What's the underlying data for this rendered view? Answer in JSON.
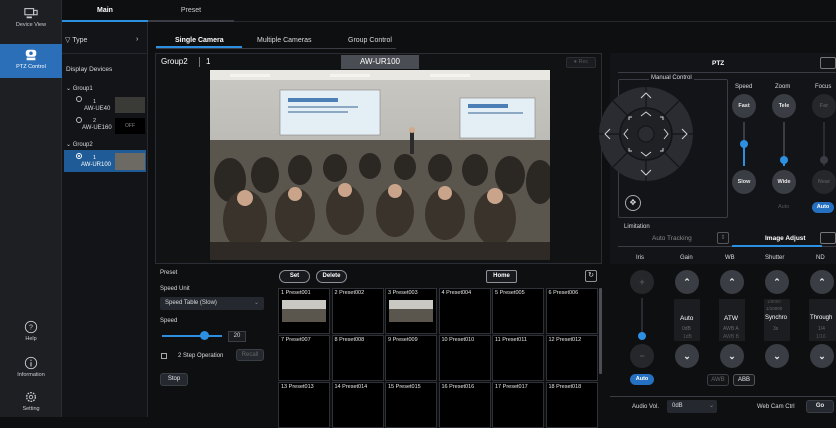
{
  "rail": {
    "device_view": "Device View",
    "ptz_control": "PTZ Control",
    "help": "Help",
    "information": "Information",
    "setting": "Setting"
  },
  "tabs": {
    "main": "Main",
    "preset": "Preset",
    "single_camera": "Single Camera",
    "multiple_cameras": "Multiple Cameras",
    "group_control": "Group Control"
  },
  "devices": {
    "type_label": "Type",
    "display_devices": "Display Devices",
    "group1": "Group1",
    "group2": "Group2",
    "dev1_num": "1",
    "dev1_name": "AW-UE40",
    "dev2_num": "2",
    "dev2_name": "AW-UE160",
    "dev2_status": "OFF",
    "dev3_num": "1",
    "dev3_name": "AW-UR100"
  },
  "viewer": {
    "group": "Group2",
    "num": "1",
    "camera_name": "AW-UR100",
    "rec": "Rec"
  },
  "preset_panel": {
    "title": "Preset",
    "speed_unit": "Speed Unit",
    "speed_table": "Speed Table (Slow)",
    "speed": "Speed",
    "speed_value": "20",
    "two_step": "2 Step Operation",
    "recall": "Recall",
    "stop": "Stop",
    "set": "Set",
    "delete": "Delete",
    "home": "Home"
  },
  "presets": [
    {
      "num": "1",
      "name": "Preset001",
      "thumb": true
    },
    {
      "num": "2",
      "name": "Preset002",
      "thumb": false
    },
    {
      "num": "3",
      "name": "Preset003",
      "thumb": true
    },
    {
      "num": "4",
      "name": "Preset004",
      "thumb": false
    },
    {
      "num": "5",
      "name": "Preset005",
      "thumb": false
    },
    {
      "num": "6",
      "name": "Preset006",
      "thumb": false
    },
    {
      "num": "7",
      "name": "Preset007",
      "thumb": false
    },
    {
      "num": "8",
      "name": "Preset008",
      "thumb": false
    },
    {
      "num": "9",
      "name": "Preset009",
      "thumb": false
    },
    {
      "num": "10",
      "name": "Preset010",
      "thumb": false
    },
    {
      "num": "11",
      "name": "Preset011",
      "thumb": false
    },
    {
      "num": "12",
      "name": "Preset012",
      "thumb": false
    },
    {
      "num": "13",
      "name": "Preset013",
      "thumb": false
    },
    {
      "num": "14",
      "name": "Preset014",
      "thumb": false
    },
    {
      "num": "15",
      "name": "Preset015",
      "thumb": false
    },
    {
      "num": "16",
      "name": "Preset016",
      "thumb": false
    },
    {
      "num": "17",
      "name": "Preset017",
      "thumb": false
    },
    {
      "num": "18",
      "name": "Preset018",
      "thumb": false
    }
  ],
  "ptz": {
    "title": "PTZ",
    "manual_control": "Manual Control",
    "speed": "Speed",
    "zoom": "Zoom",
    "focus": "Focus",
    "fast": "Fast",
    "tele": "Tele",
    "far": "Far",
    "slow": "Slow",
    "wide": "Wide",
    "near": "Near",
    "auto": "Auto",
    "auto_focus": "Auto",
    "limitation": "Limitation",
    "auto_tracking": "Auto Tracking",
    "image_adjust": "Image Adjust"
  },
  "image_adjust": {
    "iris": "Iris",
    "gain": "Gain",
    "wb": "WB",
    "shutter": "Shutter",
    "nd": "ND",
    "gain_val": "Auto",
    "gain_sub": "0dB",
    "gain_sub2": "1dB",
    "wb_val": "ATW",
    "wb_sub": "AWB A",
    "wb_sub2": "AWB B",
    "shutter_top": "1/8000",
    "shutter_top2": "1/10000",
    "shutter_val": "Synchro",
    "shutter_sub": "3s",
    "nd_val": "Through",
    "nd_sub": "1/4",
    "nd_sub2": "1/16",
    "iris_auto": "Auto",
    "awb": "AWB",
    "abb": "ABB"
  },
  "bottom": {
    "audio_vol": "Audio Vol.",
    "audio_val": "0dB",
    "webcam": "Web Cam Ctrl",
    "go": "Go"
  },
  "colors": {
    "accent": "#2d8fe0",
    "active_rail": "#2b6fb8"
  }
}
